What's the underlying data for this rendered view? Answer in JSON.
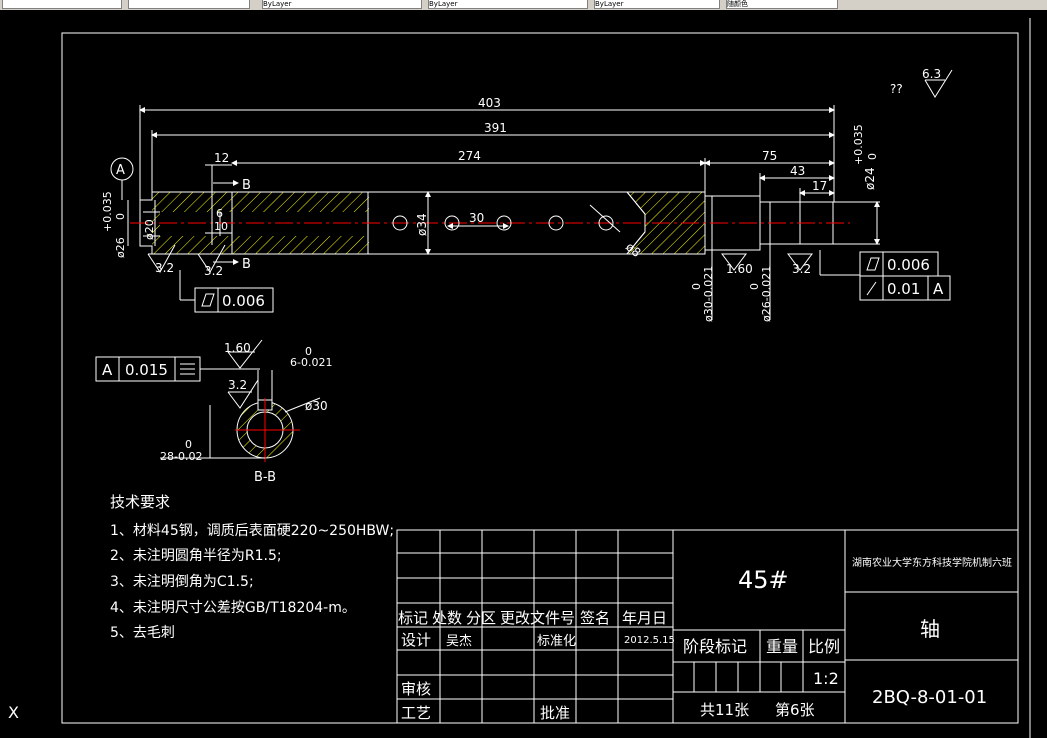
{
  "toolbar": {
    "items": [
      "",
      "",
      "ByLayer",
      "ByLayer",
      "ByLayer",
      "随颜色"
    ]
  },
  "drawing": {
    "roughness_top": "6.3",
    "roughness_prefix": "??",
    "dims": {
      "d403": "403",
      "d391": "391",
      "d274": "274",
      "d75": "75",
      "d43": "43",
      "d17": "17",
      "d12": "12",
      "d6": "6",
      "d10": "10",
      "d30": "30",
      "dia24": "ø24",
      "dia24_tol_up": "+0.035",
      "dia24_tol_low": "0",
      "dia34": "ø34",
      "dia8": "ø8",
      "dia20": "ø20",
      "dia26_left": "ø26",
      "dia26_tol_up": "+0.035",
      "dia26_tol_low": "0",
      "dia30_tol": "ø30-0.021",
      "dia30_tol_up": "0",
      "dia26_right": "ø26-0.021",
      "dia26_right_up": "0"
    },
    "section_labels": {
      "B1": "B",
      "B2": "B",
      "A_datum": "A"
    },
    "roughness": {
      "r1": "3.2",
      "r2": "3.2",
      "r3": "1.60",
      "r4": "3.2",
      "r5": "1.60",
      "r6": "3.2"
    },
    "fcf_left": {
      "value": "0.006"
    },
    "fcf_right1": {
      "value": "0.006"
    },
    "fcf_right2": {
      "value": "0.01",
      "datum": "A"
    },
    "fcf_section": {
      "datum": "A",
      "value": "0.015"
    },
    "section": {
      "label": "B-B",
      "dia30": "ø30",
      "key_width_up": "0",
      "key_width": "6-0.021",
      "depth_up": "0",
      "depth": "28-0.02"
    }
  },
  "notes": {
    "title": "技术要求",
    "lines": [
      "1、材料45钢，调质后表面硬220~250HBW;",
      "2、未注明圆角半径为R1.5;",
      "3、未注明倒角为C1.5;",
      "4、未注明尺寸公差按GB/T18204-m。",
      "5、去毛刺"
    ]
  },
  "title_block": {
    "material": "45#",
    "school": "湖南农业大学东方科技学院机制六班",
    "part_name": "轴",
    "drawing_no": "2BQ-8-01-01",
    "headers": [
      "标记",
      "处数",
      "分区",
      "更改文件号",
      "签名",
      "年月日"
    ],
    "design_label": "设计",
    "designer": "吴杰",
    "standard_label": "标准化",
    "date": "2012.5.15",
    "review_label": "审核",
    "process_label": "工艺",
    "approve_label": "批准",
    "stage_label": "阶段标记",
    "weight_label": "重量",
    "scale_label": "比例",
    "scale": "1:2",
    "total_sheets": "共11张",
    "sheet_no": "第6张"
  },
  "ucs": "X",
  "colors": {
    "background": "#000000",
    "lines": "#ffffff",
    "center": "#ff0000",
    "hatch": "#ffff00",
    "dims": "#ffffff"
  }
}
